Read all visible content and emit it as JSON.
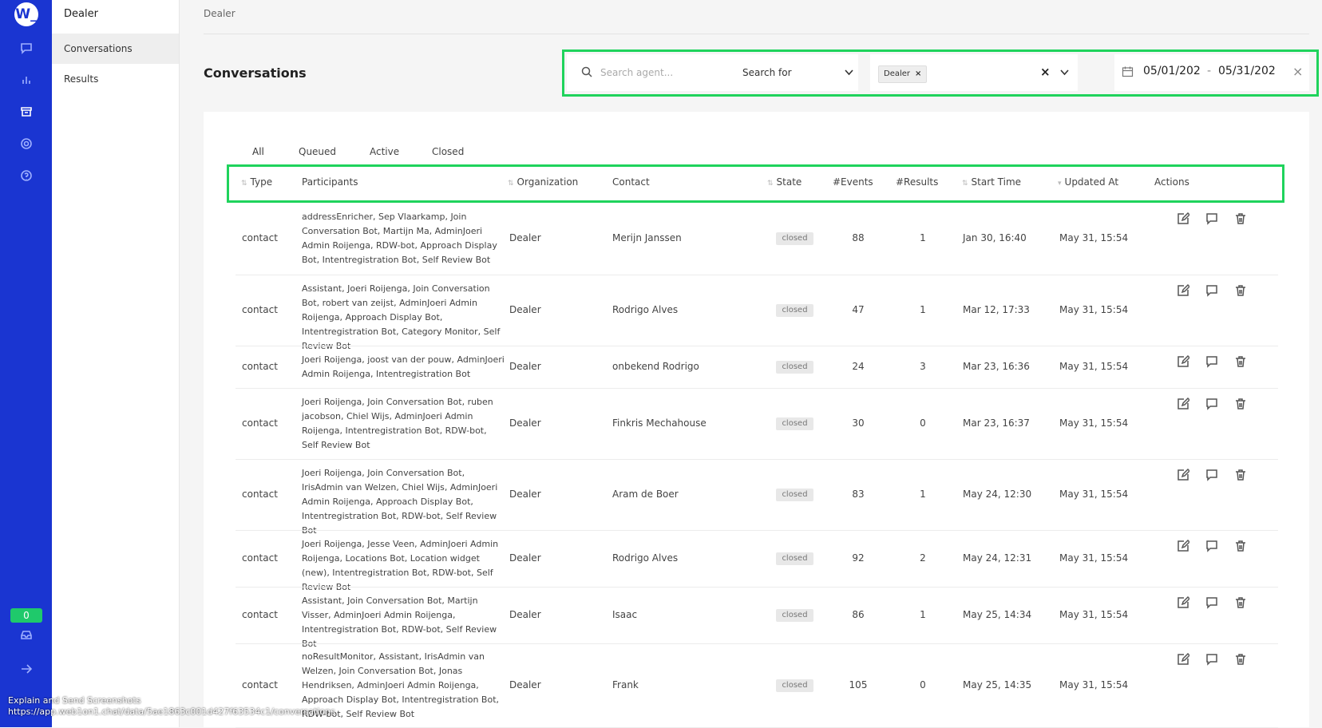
{
  "app": {
    "logo_text": "W_",
    "unread_count": "0"
  },
  "rail_icons": [
    "chat-icon",
    "chart-icon",
    "archive-icon",
    "gear-icon",
    "help-icon",
    "inbox-icon",
    "arrow-right-icon"
  ],
  "sidebar": {
    "title": "Dealer",
    "items": [
      {
        "label": "Conversations"
      },
      {
        "label": "Results"
      }
    ]
  },
  "breadcrumb": "Dealer",
  "page_title": "Conversations",
  "filters": {
    "search_placeholder": "Search agent...",
    "search_for_label": "Search for",
    "chip": "Dealer",
    "date_start": "05/01/202",
    "date_sep": "-",
    "date_end": "05/31/202"
  },
  "tabs": [
    "All",
    "Queued",
    "Active",
    "Closed"
  ],
  "columns": [
    "Type",
    "Participants",
    "Organization",
    "Contact",
    "State",
    "#Events",
    "#Results",
    "Start Time",
    "Updated At",
    "Actions"
  ],
  "rows": [
    {
      "type": "contact",
      "participants": "addressEnricher, Sep Vlaarkamp, Join Conversation Bot, Martijn Ma, AdminJoeri Admin Roijenga, RDW-bot, Approach Display Bot, Intentregistration Bot, Self Review Bot",
      "org": "Dealer",
      "contact": "Merijn Janssen",
      "state": "closed",
      "events": "88",
      "results": "1",
      "start": "Jan 30, 16:40",
      "updated": "May 31, 15:54"
    },
    {
      "type": "contact",
      "participants": "Assistant, Joeri Roijenga, Join Conversation Bot, robert van zeijst, AdminJoeri Admin Roijenga, Approach Display Bot, Intentregistration Bot, Category Monitor, Self Review Bot",
      "org": "Dealer",
      "contact": "Rodrigo Alves",
      "state": "closed",
      "events": "47",
      "results": "1",
      "start": "Mar 12, 17:33",
      "updated": "May 31, 15:54"
    },
    {
      "type": "contact",
      "participants": "Joeri Roijenga, joost van der pouw, AdminJoeri Admin Roijenga, Intentregistration Bot",
      "org": "Dealer",
      "contact": "onbekend Rodrigo",
      "state": "closed",
      "events": "24",
      "results": "3",
      "start": "Mar 23, 16:36",
      "updated": "May 31, 15:54"
    },
    {
      "type": "contact",
      "participants": "Joeri Roijenga, Join Conversation Bot, ruben jacobson, Chiel Wijs, AdminJoeri Admin Roijenga, Intentregistration Bot, RDW-bot, Self Review Bot",
      "org": "Dealer",
      "contact": "Finkris Mechahouse",
      "state": "closed",
      "events": "30",
      "results": "0",
      "start": "Mar 23, 16:37",
      "updated": "May 31, 15:54"
    },
    {
      "type": "contact",
      "participants": "Joeri Roijenga, Join Conversation Bot, IrisAdmin van Welzen, Chiel Wijs, AdminJoeri Admin Roijenga, Approach Display Bot, Intentregistration Bot, RDW-bot, Self Review Bot",
      "org": "Dealer",
      "contact": "Aram de Boer",
      "state": "closed",
      "events": "83",
      "results": "1",
      "start": "May 24, 12:30",
      "updated": "May 31, 15:54"
    },
    {
      "type": "contact",
      "participants": "Joeri Roijenga, Jesse Veen, AdminJoeri Admin Roijenga, Locations Bot, Location widget (new), Intentregistration Bot, RDW-bot, Self Review Bot",
      "org": "Dealer",
      "contact": "Rodrigo Alves",
      "state": "closed",
      "events": "92",
      "results": "2",
      "start": "May 24, 12:31",
      "updated": "May 31, 15:54"
    },
    {
      "type": "contact",
      "participants": "Assistant, Join Conversation Bot, Martijn Visser, AdminJoeri Admin Roijenga, Intentregistration Bot, RDW-bot, Self Review Bot",
      "org": "Dealer",
      "contact": "Isaac",
      "state": "closed",
      "events": "86",
      "results": "1",
      "start": "May 25, 14:34",
      "updated": "May 31, 15:54"
    },
    {
      "type": "contact",
      "participants": "noResultMonitor, Assistant, IrisAdmin van Welzen, Join Conversation Bot, Jonas Hendriksen, AdminJoeri Admin Roijenga, Approach Display Bot, Intentregistration Bot, RDW-bot, Self Review Bot",
      "org": "Dealer",
      "contact": "Frank",
      "state": "closed",
      "events": "105",
      "results": "0",
      "start": "May 25, 14:35",
      "updated": "May 31, 15:54"
    }
  ],
  "overlay": {
    "line1": "Explain and Send Screenshots",
    "line2": "https://app.web1on1.chat/data/5ae1863c001d427f63534c1/conversations"
  },
  "colors": {
    "rail": "#1a35d1",
    "highlight": "#1fd35c",
    "badge": "#1fc96b"
  }
}
